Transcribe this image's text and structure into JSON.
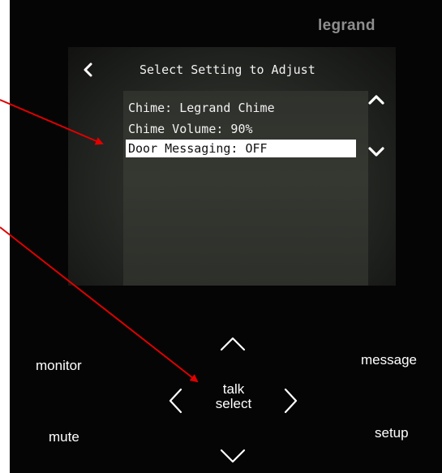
{
  "device": {
    "brand": "legrand"
  },
  "screen": {
    "title": "Select Setting to Adjust",
    "options": [
      {
        "label": "Chime: Legrand Chime",
        "selected": false
      },
      {
        "label": "Chime Volume: 90%",
        "selected": false
      },
      {
        "label": "Door Messaging: OFF",
        "selected": true
      }
    ]
  },
  "buttons": {
    "monitor": "monitor",
    "mute": "mute",
    "message": "message",
    "setup": "setup",
    "talk": "talk",
    "select": "select"
  },
  "colors": {
    "panel": "#050505",
    "screen_text": "#f0f0f0",
    "selection_highlight": "#ffffff",
    "callout_arrow": "#e00000"
  }
}
